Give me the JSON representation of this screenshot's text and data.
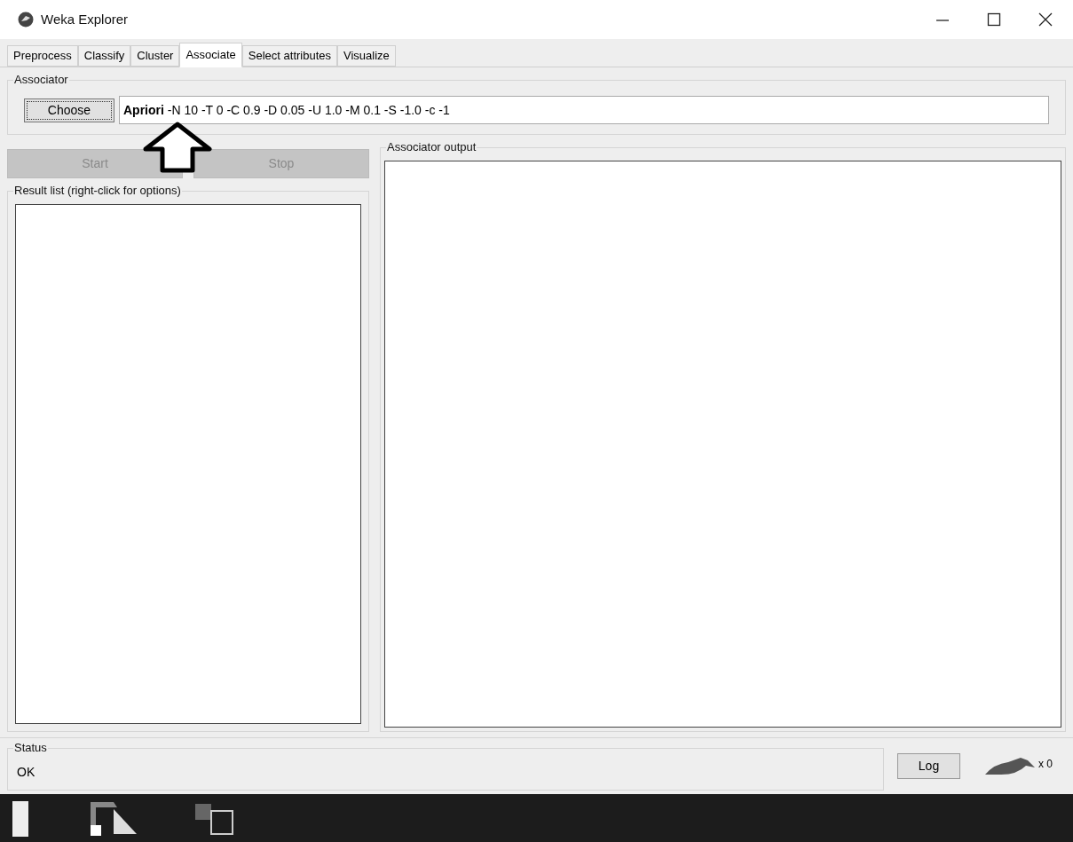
{
  "window": {
    "title": "Weka Explorer"
  },
  "tabs": [
    {
      "label": "Preprocess",
      "selected": false
    },
    {
      "label": "Classify",
      "selected": false
    },
    {
      "label": "Cluster",
      "selected": false
    },
    {
      "label": "Associate",
      "selected": true
    },
    {
      "label": "Select attributes",
      "selected": false
    },
    {
      "label": "Visualize",
      "selected": false
    }
  ],
  "associator": {
    "title": "Associator",
    "choose_button": "Choose",
    "scheme_name": "Apriori",
    "scheme_options": "-N 10 -T 0 -C 0.9 -D 0.05 -U 1.0 -M 0.1 -S -1.0 -c -1"
  },
  "run_buttons": [
    {
      "label": "Start",
      "disabled": true
    },
    {
      "label": "Stop",
      "disabled": true
    }
  ],
  "result_list": {
    "title": "Result list (right-click for options)"
  },
  "output": {
    "title": "Associator output"
  },
  "status": {
    "title": "Status",
    "message": "OK",
    "log_button": "Log",
    "task_count": "x 0"
  }
}
